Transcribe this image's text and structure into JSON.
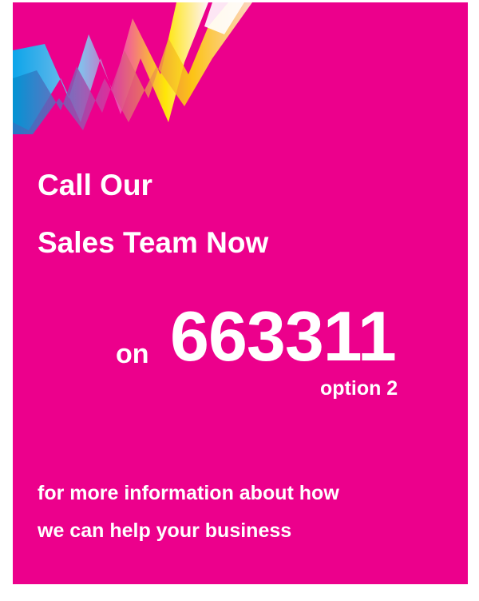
{
  "colors": {
    "background": "#ec008c",
    "text": "#ffffff",
    "ribbon_cyan": "#00aeef",
    "ribbon_magenta": "#f04fb0",
    "ribbon_yellow": "#fff200",
    "ribbon_white": "#ffffff"
  },
  "ribbon_icon": "multicolor-ribbon-graphic",
  "headline": {
    "line1": "Call Our",
    "line2": "Sales Team Now"
  },
  "contact": {
    "prefix": "on",
    "phone_number": "663311",
    "option": "option 2"
  },
  "info": {
    "line1": "for more information about how",
    "line2": "we can help your business"
  }
}
